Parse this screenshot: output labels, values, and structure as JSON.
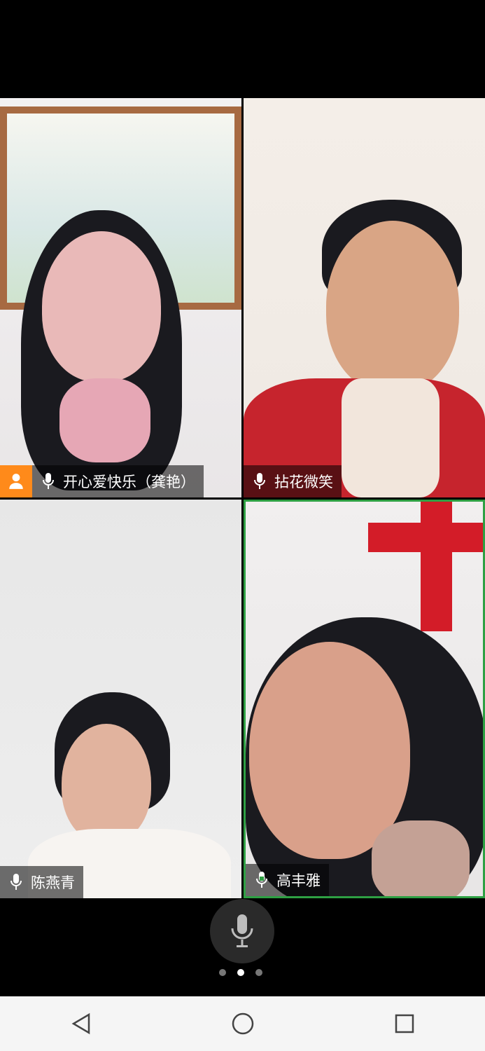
{
  "participants": [
    {
      "name": "开心爱快乐（龚艳）",
      "is_host": true,
      "icon": "mic-icon"
    },
    {
      "name": "拈花微笑",
      "is_host": false,
      "icon": "mic-icon"
    },
    {
      "name": "陈燕青",
      "is_host": false,
      "icon": "mic-icon"
    },
    {
      "name": "高丰雅",
      "is_host": false,
      "icon": "mic-icon",
      "speaking": true
    }
  ],
  "controls": {
    "mic_button_icon": "mic-icon",
    "page_dots": {
      "count": 3,
      "active_index": 1
    }
  },
  "system_nav": {
    "back_icon": "triangle-back-icon",
    "home_icon": "circle-home-icon",
    "recents_icon": "square-recents-icon"
  },
  "colors": {
    "host_badge": "#ff8a1a",
    "active_speaker_border": "#2ea043"
  }
}
